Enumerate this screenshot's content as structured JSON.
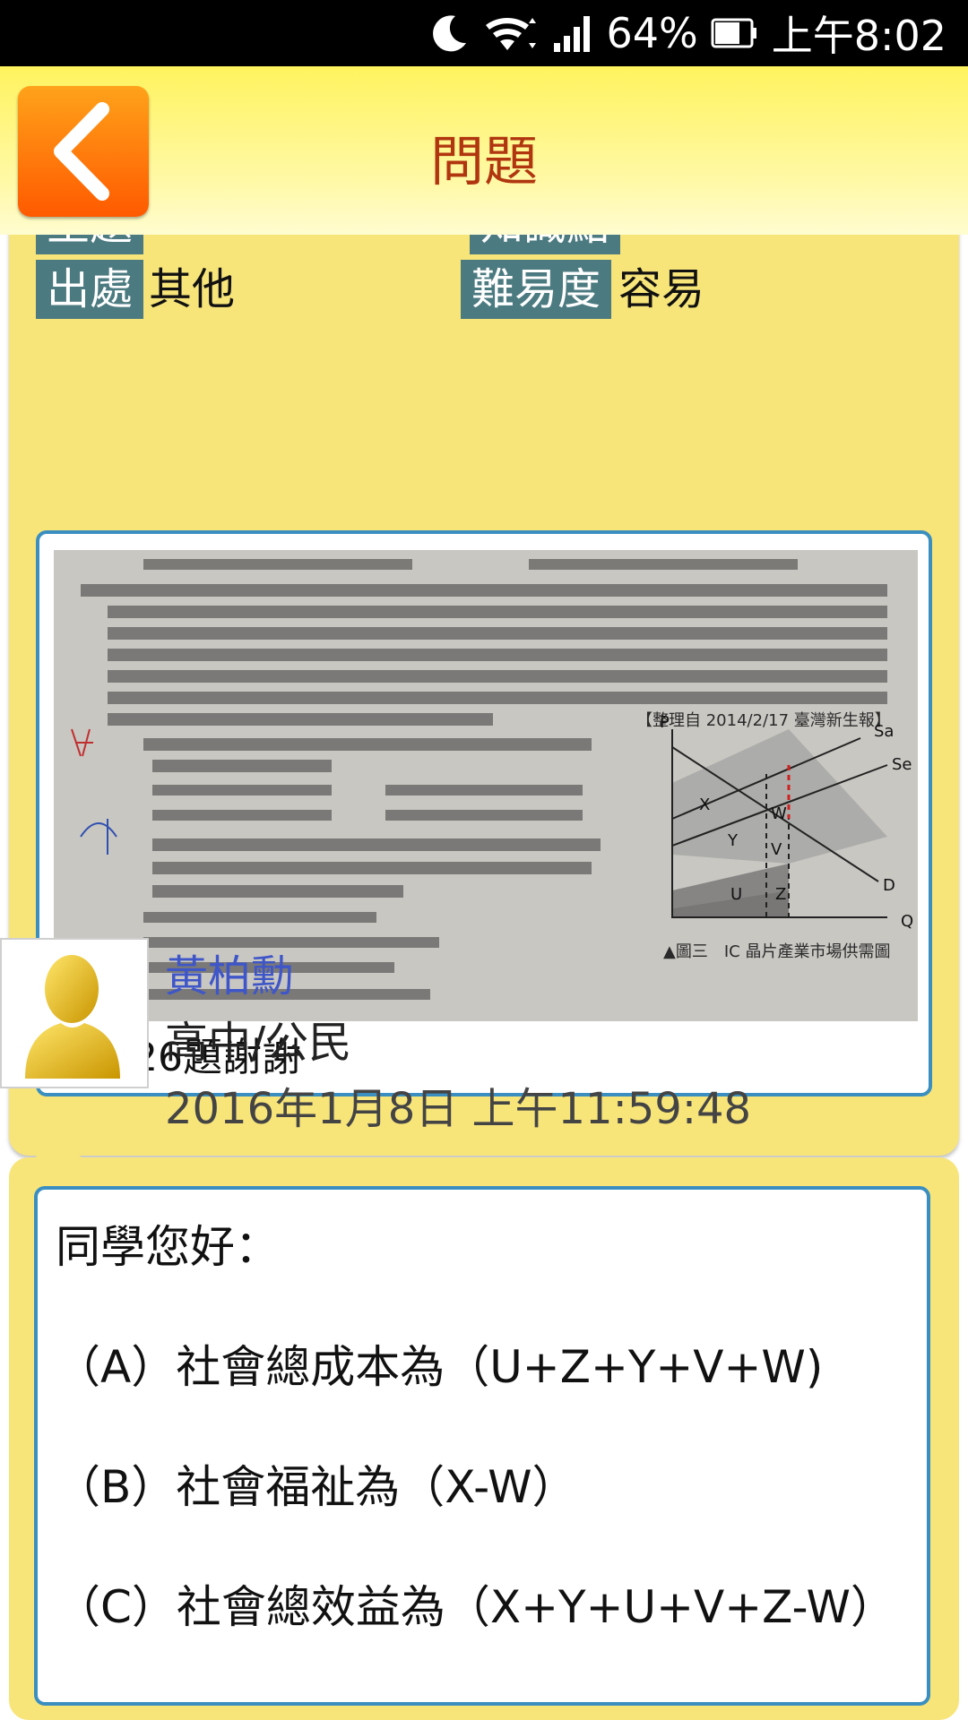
{
  "status": {
    "battery": "64%",
    "time": "上午8:02",
    "icons": [
      "moon-icon",
      "wifi-icon",
      "signal-icon",
      "battery-icon"
    ]
  },
  "header": {
    "title": "問題",
    "back_icon": "chevron-left-icon",
    "accent": "#ff7a00",
    "bg": "#fff35e"
  },
  "question": {
    "row_top_left": "主題",
    "row_top_right": "知識點",
    "source_label": "出處",
    "source_value": "其他",
    "difficulty_label": "難易度",
    "difficulty_value": "容易",
    "image_caption": "▲圖三　IC 晶片產業市場供需圖",
    "image_source": "【整理自 2014/2/17 臺灣新生報】",
    "text": "請問26題謝謝"
  },
  "teacher": {
    "name": "黃柏勳",
    "subject": "高中/公民",
    "date": "2016年1月8日 上午11:59:48"
  },
  "answer": {
    "lines": [
      "同學您好：",
      "（A）社會總成本為（U+Z+Y+V+W)",
      "（B）社會福祉為（X-W）",
      "（C）社會總效益為（X+Y+U+V+Z-W）"
    ]
  }
}
